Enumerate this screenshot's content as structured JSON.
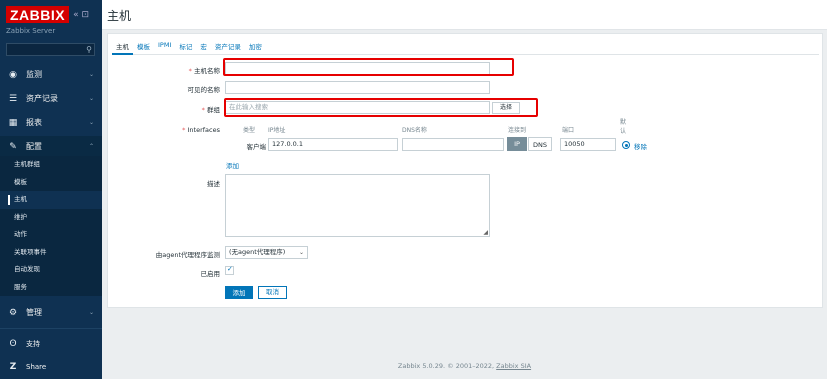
{
  "sidebar": {
    "logo": "ZABBIX",
    "collapse_icons": "« ⊡",
    "server_name": "Zabbix Server",
    "search_placeholder": "",
    "menu": [
      {
        "label": "监测",
        "icon": "eye-icon",
        "glyph": "◉"
      },
      {
        "label": "资产记录",
        "icon": "list-icon",
        "glyph": "☰"
      },
      {
        "label": "报表",
        "icon": "chart-icon",
        "glyph": "▦"
      },
      {
        "label": "配置",
        "icon": "wrench-icon",
        "glyph": "🔧"
      },
      {
        "label": "管理",
        "icon": "gear-icon",
        "glyph": "⚙"
      },
      {
        "label": "支持",
        "icon": "support-icon",
        "glyph": "ʘ"
      },
      {
        "label": "Share",
        "icon": "share-icon",
        "glyph": "Z"
      }
    ],
    "submenu": [
      "主机群组",
      "模板",
      "主机",
      "维护",
      "动作",
      "关联项事件",
      "自动发现",
      "服务"
    ]
  },
  "header": {
    "title": "主机"
  },
  "tabs": [
    "主机",
    "模板",
    "IPMI",
    "标记",
    "宏",
    "资产记录",
    "加密"
  ],
  "form": {
    "hostname_label": "主机名称",
    "hostname_value": "",
    "visible_name_label": "可见的名称",
    "visible_name_value": "",
    "groups_label": "群组",
    "groups_placeholder": "在此输入搜索",
    "groups_select": "选择",
    "interfaces_label": "Interfaces",
    "iface_headers": {
      "type": "类型",
      "ip": "IP地址",
      "dns": "DNS名称",
      "connect": "连接到",
      "port": "端口",
      "default": "默认"
    },
    "iface_row": {
      "type": "客户端",
      "ip": "127.0.0.1",
      "dns": "",
      "ip_btn": "IP",
      "dns_btn": "DNS",
      "port": "10050",
      "remove": "移除"
    },
    "add_link": "添加",
    "description_label": "描述",
    "proxy_label": "由agent代理程序监测",
    "proxy_value": "(无agent代理程序)",
    "enabled_label": "已启用",
    "add_button": "添加",
    "cancel_button": "取消"
  },
  "footer": {
    "text": "Zabbix 5.0.29. © 2001–2022, ",
    "link": "Zabbix SIA"
  },
  "colors": {
    "accent": "#0275b8",
    "sidebar": "#0f3152",
    "highlight": "#e60000"
  }
}
